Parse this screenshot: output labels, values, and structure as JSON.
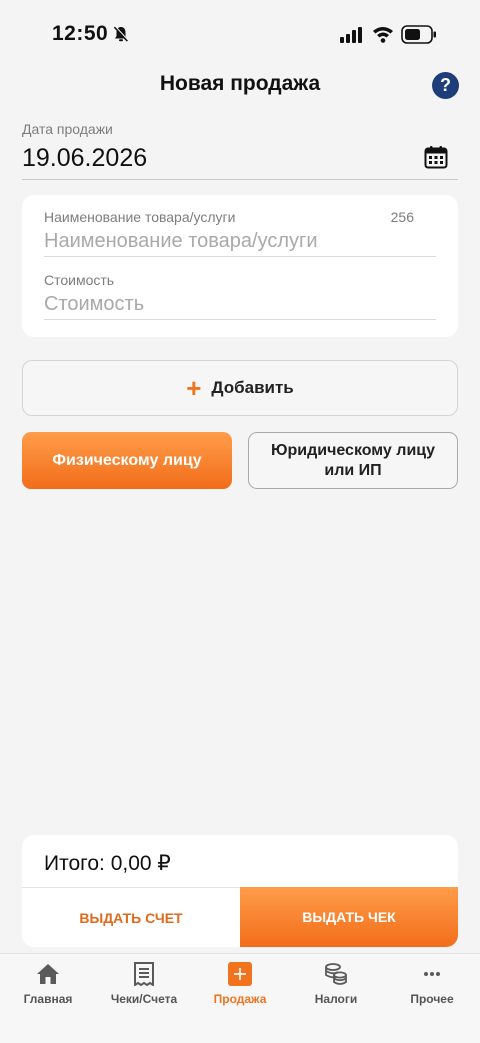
{
  "status_bar": {
    "time": "12:50"
  },
  "header": {
    "title": "Новая продажа",
    "help_label": "?"
  },
  "date_field": {
    "label": "Дата продажи",
    "value": "19.06.2026"
  },
  "item": {
    "name_label": "Наименование товара/услуги",
    "name_placeholder": "Наименование товара/услуги",
    "name_counter": "256",
    "price_label": "Стоимость",
    "price_placeholder": "Стоимость"
  },
  "add_button": {
    "label": "Добавить"
  },
  "buyer_type": {
    "individual_label": "Физическому лицу",
    "legal_label": "Юридическому лицу или ИП",
    "selected": "individual"
  },
  "total": {
    "label": "Итого: 0,00 ₽",
    "invoice_label": "ВЫДАТЬ СЧЕТ",
    "receipt_label": "ВЫДАТЬ ЧЕК"
  },
  "tabs": [
    {
      "label": "Главная",
      "icon": "home-icon"
    },
    {
      "label": "Чеки/Счета",
      "icon": "receipt-list-icon"
    },
    {
      "label": "Продажа",
      "icon": "plus-square-icon",
      "active": true
    },
    {
      "label": "Налоги",
      "icon": "coins-icon"
    },
    {
      "label": "Прочее",
      "icon": "more-dots-icon"
    }
  ],
  "colors": {
    "accent": "#f07320",
    "help": "#1e3e7b",
    "background": "#f4f4f4"
  }
}
